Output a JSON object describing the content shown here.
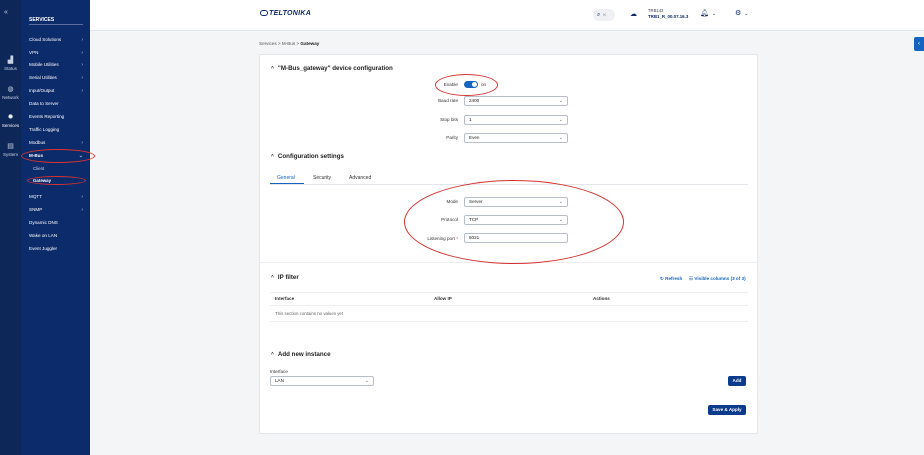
{
  "rail": {
    "collapse": "«",
    "status": "Status",
    "network": "Network",
    "services": "Services",
    "system": "System"
  },
  "sidebar": {
    "title": "SERVICES",
    "items": [
      {
        "label": "Cloud Solutions",
        "chev": "›"
      },
      {
        "label": "VPN",
        "chev": "›"
      },
      {
        "label": "Mobile Utilities",
        "chev": "›"
      },
      {
        "label": "Serial Utilities",
        "chev": "›"
      },
      {
        "label": "Input/Output",
        "chev": "›"
      },
      {
        "label": "Data to Server",
        "chev": ""
      },
      {
        "label": "Events Reporting",
        "chev": ""
      },
      {
        "label": "Traffic Logging",
        "chev": ""
      },
      {
        "label": "Modbus",
        "chev": "›"
      },
      {
        "label": "M-Bus",
        "chev": "⌄"
      },
      {
        "label": "MQTT",
        "chev": "›"
      },
      {
        "label": "SNMP",
        "chev": "›"
      },
      {
        "label": "Dynamic DNS",
        "chev": ""
      },
      {
        "label": "Wake on LAN",
        "chev": ""
      },
      {
        "label": "Event Juggler",
        "chev": ""
      }
    ],
    "sub": [
      "Client",
      "Gateway"
    ]
  },
  "topbar": {
    "logo": "TELTONIKA",
    "search_key": "K",
    "device": "TRB143",
    "firmware": "TRB1_R_00.07.16.3"
  },
  "breadcrumb": {
    "a": "Services",
    "sep": " > ",
    "b": "M-Bus",
    "c": "Gateway"
  },
  "device_cfg": {
    "title": "\"M-Bus_gateway\" device configuration",
    "enable_label": "Enable",
    "enable_value": "on",
    "baud_label": "Baud rate",
    "baud_value": "2400",
    "stop_label": "Stop bits",
    "stop_value": "1",
    "parity_label": "Parity",
    "parity_value": "Even"
  },
  "config": {
    "title": "Configuration settings",
    "tabs": [
      "General",
      "Security",
      "Advanced"
    ],
    "mode_label": "Mode",
    "mode_value": "Server",
    "protocol_label": "Protocol",
    "protocol_value": "TCP",
    "port_label": "Listening port",
    "port_req": "*",
    "port_value": "6021"
  },
  "ipfilter": {
    "title": "IP filter",
    "refresh": "Refresh",
    "visible": "Visible columns (3 of 3)",
    "cols": [
      "Interface",
      "Allow IP",
      "Actions"
    ],
    "empty": "This section contains no values yet"
  },
  "new_instance": {
    "title": "Add new instance",
    "interface_label": "Interface",
    "interface_value": "LAN",
    "add": "Add",
    "save": "Save & Apply"
  },
  "colors": {
    "accent": "#1565c0",
    "sidebar": "#0c2b6b",
    "highlight": "#d6332f"
  }
}
